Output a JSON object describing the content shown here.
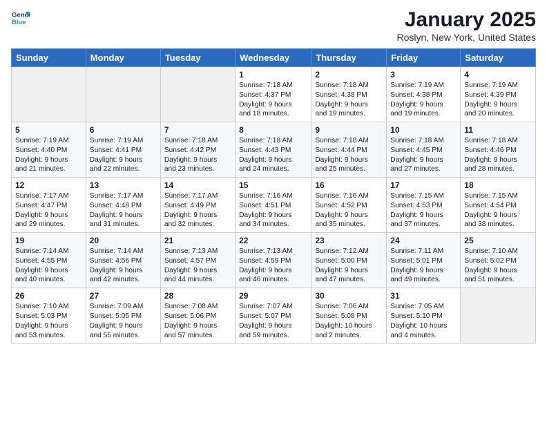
{
  "header": {
    "logo_line1": "General",
    "logo_line2": "Blue",
    "month": "January 2025",
    "location": "Roslyn, New York, United States"
  },
  "weekdays": [
    "Sunday",
    "Monday",
    "Tuesday",
    "Wednesday",
    "Thursday",
    "Friday",
    "Saturday"
  ],
  "weeks": [
    [
      {
        "day": "",
        "info": ""
      },
      {
        "day": "",
        "info": ""
      },
      {
        "day": "",
        "info": ""
      },
      {
        "day": "1",
        "info": "Sunrise: 7:18 AM\nSunset: 4:37 PM\nDaylight: 9 hours\nand 18 minutes."
      },
      {
        "day": "2",
        "info": "Sunrise: 7:18 AM\nSunset: 4:38 PM\nDaylight: 9 hours\nand 19 minutes."
      },
      {
        "day": "3",
        "info": "Sunrise: 7:19 AM\nSunset: 4:38 PM\nDaylight: 9 hours\nand 19 minutes."
      },
      {
        "day": "4",
        "info": "Sunrise: 7:19 AM\nSunset: 4:39 PM\nDaylight: 9 hours\nand 20 minutes."
      }
    ],
    [
      {
        "day": "5",
        "info": "Sunrise: 7:19 AM\nSunset: 4:40 PM\nDaylight: 9 hours\nand 21 minutes."
      },
      {
        "day": "6",
        "info": "Sunrise: 7:19 AM\nSunset: 4:41 PM\nDaylight: 9 hours\nand 22 minutes."
      },
      {
        "day": "7",
        "info": "Sunrise: 7:18 AM\nSunset: 4:42 PM\nDaylight: 9 hours\nand 23 minutes."
      },
      {
        "day": "8",
        "info": "Sunrise: 7:18 AM\nSunset: 4:43 PM\nDaylight: 9 hours\nand 24 minutes."
      },
      {
        "day": "9",
        "info": "Sunrise: 7:18 AM\nSunset: 4:44 PM\nDaylight: 9 hours\nand 25 minutes."
      },
      {
        "day": "10",
        "info": "Sunrise: 7:18 AM\nSunset: 4:45 PM\nDaylight: 9 hours\nand 27 minutes."
      },
      {
        "day": "11",
        "info": "Sunrise: 7:18 AM\nSunset: 4:46 PM\nDaylight: 9 hours\nand 28 minutes."
      }
    ],
    [
      {
        "day": "12",
        "info": "Sunrise: 7:17 AM\nSunset: 4:47 PM\nDaylight: 9 hours\nand 29 minutes."
      },
      {
        "day": "13",
        "info": "Sunrise: 7:17 AM\nSunset: 4:48 PM\nDaylight: 9 hours\nand 31 minutes."
      },
      {
        "day": "14",
        "info": "Sunrise: 7:17 AM\nSunset: 4:49 PM\nDaylight: 9 hours\nand 32 minutes."
      },
      {
        "day": "15",
        "info": "Sunrise: 7:16 AM\nSunset: 4:51 PM\nDaylight: 9 hours\nand 34 minutes."
      },
      {
        "day": "16",
        "info": "Sunrise: 7:16 AM\nSunset: 4:52 PM\nDaylight: 9 hours\nand 35 minutes."
      },
      {
        "day": "17",
        "info": "Sunrise: 7:15 AM\nSunset: 4:53 PM\nDaylight: 9 hours\nand 37 minutes."
      },
      {
        "day": "18",
        "info": "Sunrise: 7:15 AM\nSunset: 4:54 PM\nDaylight: 9 hours\nand 38 minutes."
      }
    ],
    [
      {
        "day": "19",
        "info": "Sunrise: 7:14 AM\nSunset: 4:55 PM\nDaylight: 9 hours\nand 40 minutes."
      },
      {
        "day": "20",
        "info": "Sunrise: 7:14 AM\nSunset: 4:56 PM\nDaylight: 9 hours\nand 42 minutes."
      },
      {
        "day": "21",
        "info": "Sunrise: 7:13 AM\nSunset: 4:57 PM\nDaylight: 9 hours\nand 44 minutes."
      },
      {
        "day": "22",
        "info": "Sunrise: 7:13 AM\nSunset: 4:59 PM\nDaylight: 9 hours\nand 46 minutes."
      },
      {
        "day": "23",
        "info": "Sunrise: 7:12 AM\nSunset: 5:00 PM\nDaylight: 9 hours\nand 47 minutes."
      },
      {
        "day": "24",
        "info": "Sunrise: 7:11 AM\nSunset: 5:01 PM\nDaylight: 9 hours\nand 49 minutes."
      },
      {
        "day": "25",
        "info": "Sunrise: 7:10 AM\nSunset: 5:02 PM\nDaylight: 9 hours\nand 51 minutes."
      }
    ],
    [
      {
        "day": "26",
        "info": "Sunrise: 7:10 AM\nSunset: 5:03 PM\nDaylight: 9 hours\nand 53 minutes."
      },
      {
        "day": "27",
        "info": "Sunrise: 7:09 AM\nSunset: 5:05 PM\nDaylight: 9 hours\nand 55 minutes."
      },
      {
        "day": "28",
        "info": "Sunrise: 7:08 AM\nSunset: 5:06 PM\nDaylight: 9 hours\nand 57 minutes."
      },
      {
        "day": "29",
        "info": "Sunrise: 7:07 AM\nSunset: 5:07 PM\nDaylight: 9 hours\nand 59 minutes."
      },
      {
        "day": "30",
        "info": "Sunrise: 7:06 AM\nSunset: 5:08 PM\nDaylight: 10 hours\nand 2 minutes."
      },
      {
        "day": "31",
        "info": "Sunrise: 7:05 AM\nSunset: 5:10 PM\nDaylight: 10 hours\nand 4 minutes."
      },
      {
        "day": "",
        "info": ""
      }
    ]
  ]
}
